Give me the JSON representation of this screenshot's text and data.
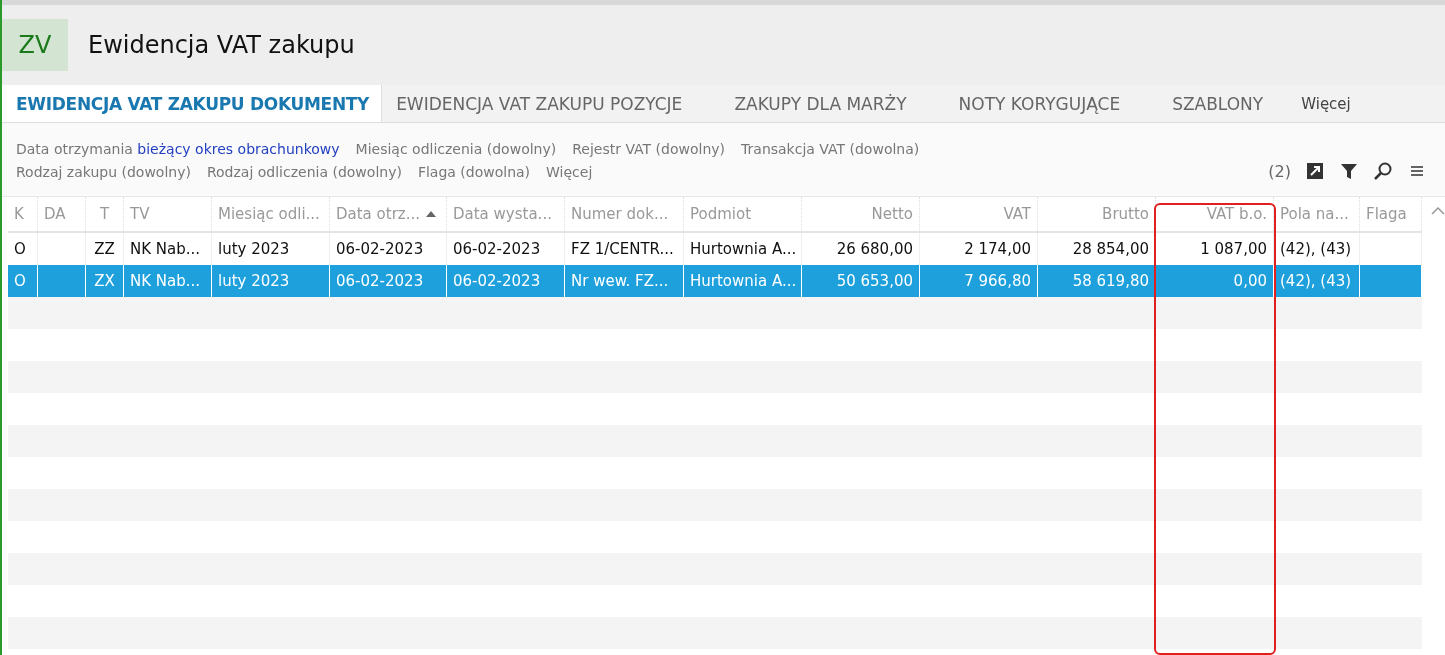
{
  "header": {
    "badge": "ZV",
    "title": "Ewidencja VAT zakupu"
  },
  "tabs": [
    {
      "label": "EWIDENCJA VAT ZAKUPU DOKUMENTY",
      "selected": true
    },
    {
      "label": "EWIDENCJA VAT ZAKUPU POZYCJE",
      "selected": false
    },
    {
      "label": "ZAKUPY DLA MARŻY",
      "selected": false
    },
    {
      "label": "NOTY KORYGUJĄCE",
      "selected": false
    },
    {
      "label": "SZABLONY",
      "selected": false
    }
  ],
  "tabs_more": "Więcej",
  "filters": [
    [
      {
        "label": "Data otrzymania",
        "value": "bieżący okres obrachunkowy"
      },
      {
        "label": "Miesiąc odliczenia (dowolny)"
      },
      {
        "label": "Rejestr VAT (dowolny)"
      },
      {
        "label": "Transakcja VAT (dowolna)"
      }
    ],
    [
      {
        "label": "Rodzaj zakupu (dowolny)"
      },
      {
        "label": "Rodzaj odliczenia (dowolny)"
      },
      {
        "label": "Flaga (dowolna)"
      },
      {
        "label": "Więcej"
      }
    ]
  ],
  "toolbar": {
    "count": "(2)"
  },
  "table": {
    "columns": [
      {
        "label": "K",
        "kind": "text",
        "sorted": false,
        "highlighted": false
      },
      {
        "label": "DA",
        "kind": "text",
        "sorted": false,
        "highlighted": false
      },
      {
        "label": "T",
        "kind": "center",
        "sorted": false,
        "highlighted": false
      },
      {
        "label": "TV",
        "kind": "text",
        "sorted": false,
        "highlighted": false
      },
      {
        "label": "Miesiąc odli...",
        "kind": "text",
        "sorted": false,
        "highlighted": false
      },
      {
        "label": "Data otrz...",
        "kind": "text",
        "sorted": true,
        "highlighted": false
      },
      {
        "label": "Data wysta...",
        "kind": "text",
        "sorted": false,
        "highlighted": false
      },
      {
        "label": "Numer dok...",
        "kind": "text",
        "sorted": false,
        "highlighted": false
      },
      {
        "label": "Podmiot",
        "kind": "text",
        "sorted": false,
        "highlighted": false
      },
      {
        "label": "Netto",
        "kind": "amount",
        "sorted": false,
        "highlighted": false
      },
      {
        "label": "VAT",
        "kind": "amount",
        "sorted": false,
        "highlighted": false
      },
      {
        "label": "Brutto",
        "kind": "amount",
        "sorted": false,
        "highlighted": false
      },
      {
        "label": "VAT b.o.",
        "kind": "amount",
        "sorted": false,
        "highlighted": true
      },
      {
        "label": "Pola na...",
        "kind": "text",
        "sorted": false,
        "highlighted": false
      },
      {
        "label": "Flaga",
        "kind": "text",
        "sorted": false,
        "highlighted": false
      }
    ],
    "rows": [
      {
        "selected": false,
        "cells": [
          "O",
          "",
          "ZZ",
          "NK Nab...",
          "luty 2023",
          "06-02-2023",
          "06-02-2023",
          "FZ 1/CENTR...",
          "Hurtownia A...",
          "26 680,00",
          "2 174,00",
          "28 854,00",
          "1 087,00",
          "(42), (43)",
          ""
        ]
      },
      {
        "selected": true,
        "cells": [
          "O",
          "",
          "ZX",
          "NK Nab...",
          "luty 2023",
          "06-02-2023",
          "06-02-2023",
          "Nr wew. FZ...",
          "Hurtownia A...",
          "50 653,00",
          "7 966,80",
          "58 619,80",
          "0,00",
          "(42), (43)",
          ""
        ]
      }
    ]
  }
}
